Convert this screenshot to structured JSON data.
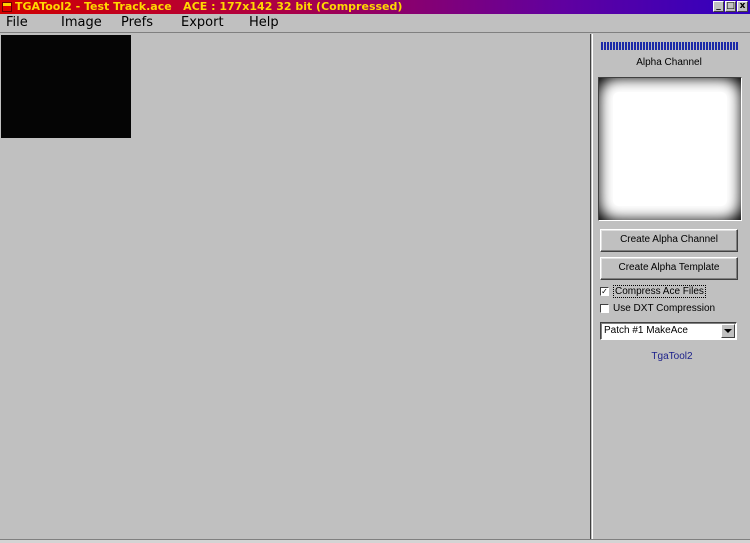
{
  "window": {
    "title": "TGATool2 - Test Track.ace   ACE : 177x142 32 bit (Compressed)",
    "minimize": "_",
    "maximize": "□",
    "close": "x"
  },
  "menu": [
    "File",
    "Image",
    "Prefs",
    "Export",
    "Help"
  ],
  "panel": {
    "progress_percent": 100,
    "alpha_label": "Alpha Channel",
    "create_alpha_channel": "Create Alpha Channel",
    "create_alpha_template": "Create Alpha Template",
    "compress_ace": {
      "label": "Compress Ace Files",
      "checked": true,
      "mark": "✓"
    },
    "use_dxt": {
      "label": "Use DXT Compression",
      "checked": false,
      "mark": ""
    },
    "patch_select": "Patch #1 MakeAce",
    "brand": "TgaTool2"
  },
  "colors": {
    "accent": "#1c2aa8",
    "title_text": "#ffd800",
    "brand_text": "#1a1f8a"
  }
}
